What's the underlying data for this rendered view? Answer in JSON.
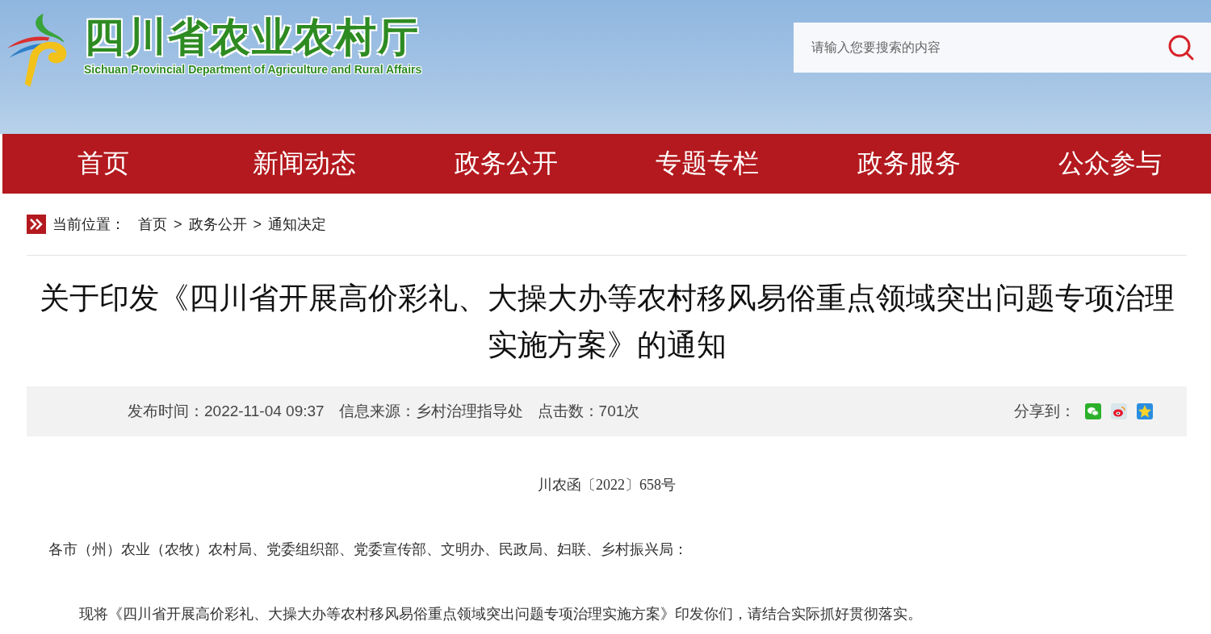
{
  "header": {
    "logo_title": "四川省农业农村厅",
    "logo_subtitle": "Sichuan Provincial Department of Agriculture and Rural Affairs",
    "search": {
      "placeholder": "请输入您要搜索的内容"
    }
  },
  "nav": [
    {
      "label": "首页",
      "selected": false
    },
    {
      "label": "新闻动态",
      "selected": false
    },
    {
      "label": "政务公开",
      "selected": false
    },
    {
      "label": "专题专栏",
      "selected": false
    },
    {
      "label": "政务服务",
      "selected": false
    },
    {
      "label": "公众参与",
      "selected": false
    }
  ],
  "breadcrumb": {
    "label": "当前位置：",
    "items": [
      "首页",
      "政务公开",
      "通知决定"
    ],
    "separator": ">"
  },
  "article": {
    "title": "关于印发《四川省开展高价彩礼、大操大办等农村移风易俗重点领域突出问题专项治理实施方案》的通知",
    "meta": [
      "发布时间：2022-11-04 09:37",
      "信息来源：乡村治理指导处",
      "点击数：701次"
    ],
    "share_label": "分享到：",
    "share": [
      {
        "kind": "wechat"
      },
      {
        "kind": "weibo"
      },
      {
        "kind": "qzone"
      }
    ],
    "doc_number": "川农函〔2022〕658号",
    "salutation": "各市（州）农业（农牧）农村局、党委组织部、党委宣传部、文明办、民政局、妇联、乡村振兴局：",
    "paragraphs": [
      "现将《四川省开展高价彩礼、大操大办等农村移风易俗重点领域突出问题专项治理实施方案》印发你们，请结合实际抓好贯彻落实。"
    ]
  }
}
